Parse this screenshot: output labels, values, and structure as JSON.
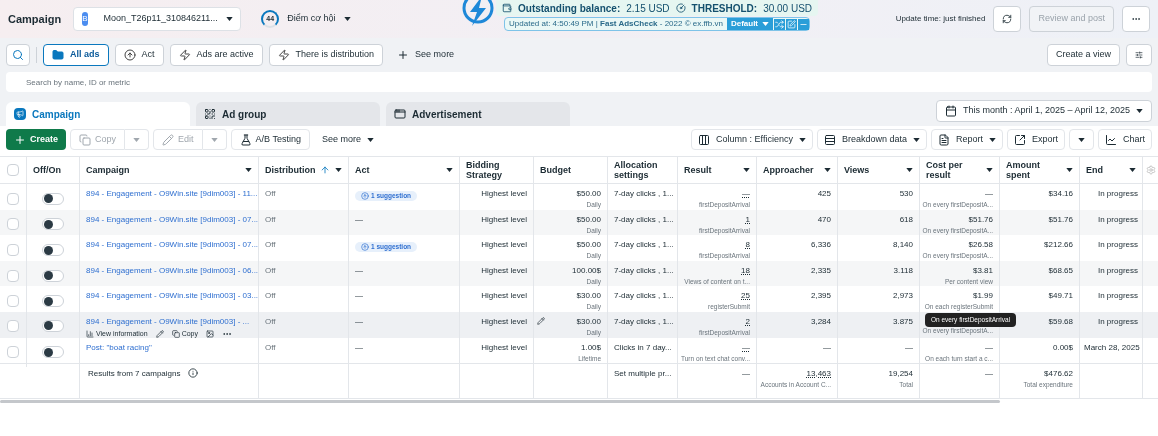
{
  "header": {
    "title": "Campaign",
    "account": {
      "badge": "B",
      "name": "Moon_T26p11_310846211..."
    },
    "score": {
      "value": "44",
      "label": "Điểm cơ hội"
    },
    "update_time": "Update time: just finished",
    "review": "Review and post"
  },
  "extension": {
    "balance_label": "Outstanding balance:",
    "balance": "2.15 USD",
    "threshold_label": "THRESHOLD:",
    "threshold": "30.00 USD",
    "updated": "Updated at: 4:50:49 PM | **Fast AdsCheck** - 2022 © ex.ffb.vn",
    "preset": "Default"
  },
  "filters": [
    {
      "kind": "folder",
      "label": "All ads",
      "selected": true
    },
    {
      "kind": "arrow",
      "label": "Act",
      "selected": false
    },
    {
      "kind": "bolt",
      "label": "Ads are active",
      "selected": false
    },
    {
      "kind": "bolt",
      "label": "There is distribution",
      "selected": false
    }
  ],
  "see_more": "See more",
  "search": {
    "placeholder": "Search by name, ID or metric"
  },
  "create_view": "Create a view",
  "tabs": [
    {
      "kind": "campaign",
      "label": "Campaign",
      "selected": true
    },
    {
      "kind": "group",
      "label": "Ad group",
      "selected": false
    },
    {
      "kind": "ad",
      "label": "Advertisement",
      "selected": false
    }
  ],
  "date_range": "This month : April 1, 2025 – April 12, 2025",
  "toolbar": {
    "create": "Create",
    "copy": {
      "label": "Copy",
      "disabled": true
    },
    "edit": {
      "label": "Edit",
      "disabled": true
    },
    "ab": "A/B Testing",
    "more": "See more",
    "right": [
      {
        "kind": "columns",
        "label": "Column : Efficiency"
      },
      {
        "kind": "breakdown",
        "label": "Breakdown data"
      },
      {
        "kind": "report",
        "label": "Report"
      },
      {
        "kind": "export",
        "label": "Export"
      },
      {
        "kind": "chart",
        "label": "Chart"
      }
    ]
  },
  "select_all": false,
  "columns": [
    {
      "label": "Off/On",
      "menu": false,
      "sorted": false
    },
    {
      "label": "Campaign",
      "menu": true,
      "sorted": false
    },
    {
      "label": "Distribution",
      "menu": true,
      "sorted": true
    },
    {
      "label": "Act",
      "menu": true,
      "sorted": false
    },
    {
      "label": "Bidding Strategy",
      "menu": false,
      "sorted": false
    },
    {
      "label": "Budget",
      "menu": false,
      "sorted": false
    },
    {
      "label": "Allocation settings",
      "menu": false,
      "sorted": false
    },
    {
      "label": "Result",
      "menu": true,
      "sorted": false
    },
    {
      "label": "Approacher",
      "menu": true,
      "sorted": false
    },
    {
      "label": "Views",
      "menu": true,
      "sorted": false
    },
    {
      "label": "Cost per result",
      "menu": true,
      "sorted": false
    },
    {
      "label": "Amount spent",
      "menu": true,
      "sorted": false
    },
    {
      "label": "End",
      "menu": true,
      "sorted": false
    }
  ],
  "rows": [
    {
      "checked": false,
      "on": false,
      "campaign": "894 - Engagement - O9Win.site [9dim003] - 11...",
      "distribution": "Off",
      "act": {
        "kind": "suggestion",
        "text": "1 suggestion"
      },
      "bidding": "Highest level",
      "budget": "$50.00",
      "budget_type": "Daily",
      "allocation": "7-day clicks , 1...",
      "result": "—",
      "result_note": "firstDepositArrival",
      "approacher": "425",
      "views": "530",
      "cost": "—",
      "cost_note": "On every firstDepositA...",
      "spent": "$34.16",
      "end": "In progress"
    },
    {
      "checked": false,
      "on": false,
      "campaign": "894 - Engagement - O9Win.site [9dim003] - 07...",
      "distribution": "Off",
      "act": {
        "kind": "dash",
        "text": "—"
      },
      "bidding": "Highest level",
      "budget": "$50.00",
      "budget_type": "Daily",
      "allocation": "7-day clicks , 1...",
      "result": "1",
      "result_note": "firstDepositArrival",
      "approacher": "470",
      "views": "618",
      "cost": "$51.76",
      "cost_note": "On every firstDepositA...",
      "spent": "$51.76",
      "end": "In progress"
    },
    {
      "checked": false,
      "on": false,
      "campaign": "894 - Engagement - O9Win.site [9dim003] - 07...",
      "distribution": "Off",
      "act": {
        "kind": "suggestion",
        "text": "1 suggestion"
      },
      "bidding": "Highest level",
      "budget": "$50.00",
      "budget_type": "Daily",
      "allocation": "7-day clicks , 1...",
      "result": "8",
      "result_note": "firstDepositArrival",
      "approacher": "6,336",
      "views": "8,140",
      "cost": "$26.58",
      "cost_note": "On every firstDepositA...",
      "spent": "$212.66",
      "end": "In progress"
    },
    {
      "checked": false,
      "on": false,
      "campaign": "894 - Engagement - O9Win.site [9dim003] - 06...",
      "distribution": "Off",
      "act": {
        "kind": "dash",
        "text": "—"
      },
      "bidding": "Highest level",
      "budget": "100.00$",
      "budget_type": "Daily",
      "allocation": "7-day clicks , 1...",
      "result": "18",
      "result_note": "Views of content on t...",
      "approacher": "2,335",
      "views": "3.118",
      "cost": "$3.81",
      "cost_note": "Per content view",
      "spent": "$68.65",
      "end": "In progress"
    },
    {
      "checked": false,
      "on": false,
      "campaign": "894 - Engagement - O9Win.site [9dim003] - 03...",
      "distribution": "Off",
      "act": {
        "kind": "dash",
        "text": "—"
      },
      "bidding": "Highest level",
      "budget": "$30.00",
      "budget_type": "Daily",
      "allocation": "7-day clicks , 1...",
      "result": "25",
      "result_note": "registerSubmit",
      "approacher": "2,395",
      "views": "2,973",
      "cost": "$1.99",
      "cost_note": "On each registerSubmit",
      "spent": "$49.71",
      "end": "In progress"
    },
    {
      "checked": false,
      "on": false,
      "campaign": "894 - Engagement - O9Win.site [9dim003] - ...",
      "actions": {
        "view": "View information",
        "copy": "Copy"
      },
      "distribution": "Off",
      "act": {
        "kind": "dash",
        "text": "—"
      },
      "bidding": "Highest level",
      "budget": "$30.00",
      "budget_type": "Daily",
      "allocation": "7-day clicks , 1...",
      "result": "2",
      "result_note": "firstDepositArrival",
      "approacher": "3,284",
      "views": "3.875",
      "cost_note": "On every firstDepositA...",
      "tooltip": "On every firstDepositArrival",
      "spent": "$59.68",
      "end": "In progress"
    },
    {
      "checked": false,
      "on": false,
      "campaign": "Post: \"boat racing\"",
      "distribution": "Off",
      "act": {
        "kind": "dash",
        "text": "—"
      },
      "bidding": "Highest level",
      "budget": "1.00$",
      "budget_type": "Lifetime",
      "allocation": "Clicks in 7 day...",
      "result": "—",
      "result_note": "Turn on text chat conv...",
      "approacher": "—",
      "views": "—",
      "cost": "—",
      "cost_note": "On each turn start a c...",
      "spent": "0.00$",
      "end": "March 28, 2025"
    }
  ],
  "summary": {
    "label": "Results from 7 campaigns",
    "allocation": "Set multiple pr...",
    "result": "—",
    "approacher": "13,463",
    "approacher_note": "Accounts in Account C...",
    "views": "19,254",
    "views_note": "Total",
    "cost": "—",
    "spent": "$476.62",
    "spent_note": "Total expenditure"
  }
}
